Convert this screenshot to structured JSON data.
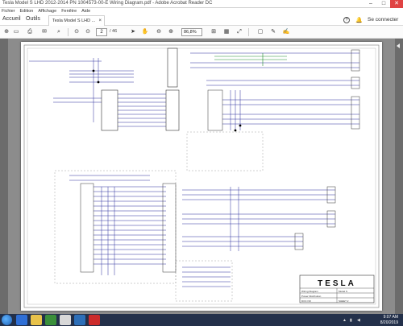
{
  "window": {
    "title": "Tesla Model S LHD 2012-2014 PN 1004573-00-E Wiring Diagram.pdf - Adobe Acrobat Reader DC",
    "controls": [
      "–",
      "□",
      "✕"
    ]
  },
  "menu": {
    "items": [
      "Fichier",
      "Edition",
      "Affichage",
      "Fenêtre",
      "Aide"
    ]
  },
  "tabs": {
    "home": "Accueil",
    "tools": "Outils",
    "document": "Tesla Model S LHD ...",
    "signin": "Se connecter"
  },
  "toolbar": {
    "page_current": "2",
    "page_total": "/ 46",
    "zoom": "86,8%"
  },
  "drawing": {
    "brand": "TESLA",
    "title_rows": [
      "Wiring Diagram",
      "Model S",
      "Power Distribution",
      "DOC NO",
      "SHEET 2"
    ]
  },
  "taskbar": {
    "time": "9:07 AM",
    "date": "8/20/2019"
  },
  "colors": {
    "accent_red": "#e04343",
    "taskbar_bg": "#23304a",
    "canvas_gray": "#8c8c8c",
    "wire_blue": "#2b2f9e",
    "wire_green": "#1f8a2b"
  }
}
